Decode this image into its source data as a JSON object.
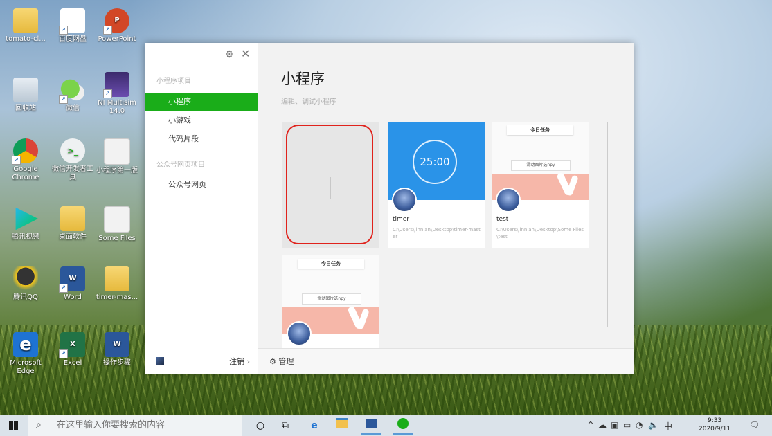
{
  "desktop": {
    "icons": [
      {
        "label": "tomato-cl...",
        "icon": "folder-icon"
      },
      {
        "label": "百度网盘",
        "icon": "baidu-netdisk-icon"
      },
      {
        "label": "PowerPoint",
        "icon": "powerpoint-icon"
      },
      {
        "label": "回收站",
        "icon": "recycle-bin-icon"
      },
      {
        "label": "微信",
        "icon": "wechat-icon"
      },
      {
        "label": "NI Multisim 14.0",
        "icon": "multisim-icon"
      },
      {
        "label": "Google Chrome",
        "icon": "chrome-icon"
      },
      {
        "label": "微信开发者工具",
        "icon": "wechat-devtools-icon"
      },
      {
        "label": "小程序第一版",
        "icon": "document-icon"
      },
      {
        "label": "腾讯视频",
        "icon": "tencent-video-icon"
      },
      {
        "label": "桌面软件",
        "icon": "folder-icon"
      },
      {
        "label": "Some Files",
        "icon": "document-icon"
      },
      {
        "label": "腾讯QQ",
        "icon": "qq-icon"
      },
      {
        "label": "Word",
        "icon": "word-icon"
      },
      {
        "label": "timer-mas...",
        "icon": "folder-icon"
      },
      {
        "label": "Microsoft Edge",
        "icon": "edge-icon"
      },
      {
        "label": "Excel",
        "icon": "excel-icon"
      },
      {
        "label": "操作步骤",
        "icon": "word-doc-icon"
      }
    ]
  },
  "app": {
    "sidebar": {
      "section1": "小程序项目",
      "items1": [
        "小程序",
        "小游戏",
        "代码片段"
      ],
      "section2": "公众号网页项目",
      "items2": [
        "公众号网页"
      ],
      "logout_label": "注销 ›"
    },
    "main": {
      "title": "小程序",
      "subtitle": "编辑、调试小程序",
      "projects": [
        {
          "name": "timer",
          "path": "C:\\Users\\jinnian\\Desktop\\timer-master",
          "thumb_text": "25:00"
        },
        {
          "name": "test",
          "path": "C:\\Users\\jinnian\\Desktop\\Some Files\\test",
          "thumb_head": "今日任务",
          "thumb_mid": "滑动图片选npy"
        },
        {
          "name": "",
          "path": "",
          "thumb_head": "今日任务",
          "thumb_mid": "滑动图片选npy"
        }
      ],
      "manage_label": "管理"
    }
  },
  "taskbar": {
    "search_placeholder": "在这里输入你要搜索的内容",
    "ime": "中",
    "time": "9:33",
    "date": "2020/9/11"
  },
  "colors": {
    "accent": "#1aad19",
    "highlight": "#e0221c",
    "timer_blue": "#2a93e8"
  }
}
